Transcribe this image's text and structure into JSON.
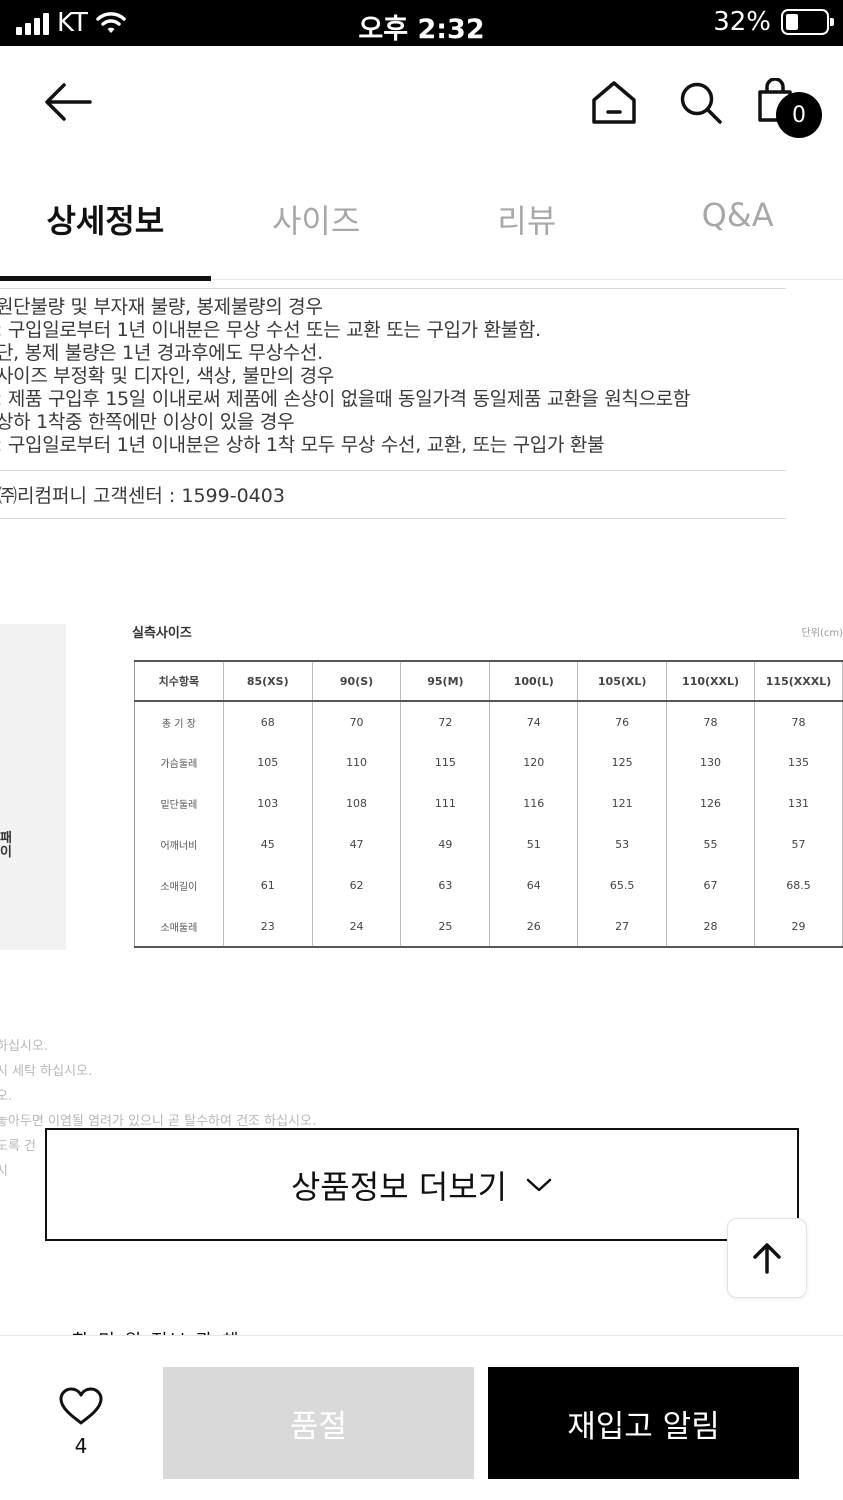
{
  "status_bar": {
    "carrier": "KT",
    "time": "오후 2:32",
    "battery_percent": "32%",
    "battery_level": 0.32
  },
  "header": {
    "icons": [
      "back-arrow-icon",
      "home-icon",
      "search-icon",
      "shopping-bag-icon"
    ],
    "cart_count": "0"
  },
  "tabs": [
    {
      "label": "상세정보",
      "active": true
    },
    {
      "label": "사이즈",
      "active": false
    },
    {
      "label": "리뷰",
      "active": false
    },
    {
      "label": "Q&A",
      "active": false
    }
  ],
  "notice": {
    "lines": [
      "원단불량 및 부자재 불량, 봉제불량의 경우",
      ": 구입일로부터 1년 이내분은 무상 수선 또는 교환 또는 구입가 환불함.",
      "단, 봉제 불량은 1년 경과후에도 무상수선.",
      "사이즈 부정확 및 디자인, 색상, 불만의 경우",
      ": 제품 구입후 15일 이내로써 제품에 손상이 없을때 동일가격 동일제품 교환을 원칙으로함",
      "상하 1착중 한쪽에만 이상이 있을 경우",
      ": 구입일로부터 1년 이내분은 상하 1착 모두 무상 수선, 교환, 또는 구입가 환불"
    ],
    "customer_center": "㈜리컴퍼니 고객센터 : 1599-0403"
  },
  "size_chart": {
    "side_text": "패\n이",
    "title": "실측사이즈",
    "unit": "단위(cm)",
    "headers": [
      "치수항목",
      "85(XS)",
      "90(S)",
      "95(M)",
      "100(L)",
      "105(XL)",
      "110(XXL)",
      "115(XXXL)"
    ],
    "rows": [
      [
        "총 기 장",
        "68",
        "70",
        "72",
        "74",
        "76",
        "78",
        "78"
      ],
      [
        "가슴둘레",
        "105",
        "110",
        "115",
        "120",
        "125",
        "130",
        "135"
      ],
      [
        "밑단둘레",
        "103",
        "108",
        "111",
        "116",
        "121",
        "126",
        "131"
      ],
      [
        "어깨너비",
        "45",
        "47",
        "49",
        "51",
        "53",
        "55",
        "57"
      ],
      [
        "소매길이",
        "61",
        "62",
        "63",
        "64",
        "65.5",
        "67",
        "68.5"
      ],
      [
        "소매둘레",
        "23",
        "24",
        "25",
        "26",
        "27",
        "28",
        "29"
      ]
    ]
  },
  "care_text": [
    "하십시오.",
    "시 세탁 하십시오.",
    "오.",
    "놓아두면 이염될 염려가 있으니 곧 탈수하여 건조 하십시오.",
    "도록 건",
    "시"
  ],
  "more_button": {
    "label": "상품정보 더보기"
  },
  "peek_text": "한 민 원 정보 관 체",
  "bottom_bar": {
    "like_count": "4",
    "soldout_label": "품절",
    "restock_label": "재입고 알림"
  }
}
